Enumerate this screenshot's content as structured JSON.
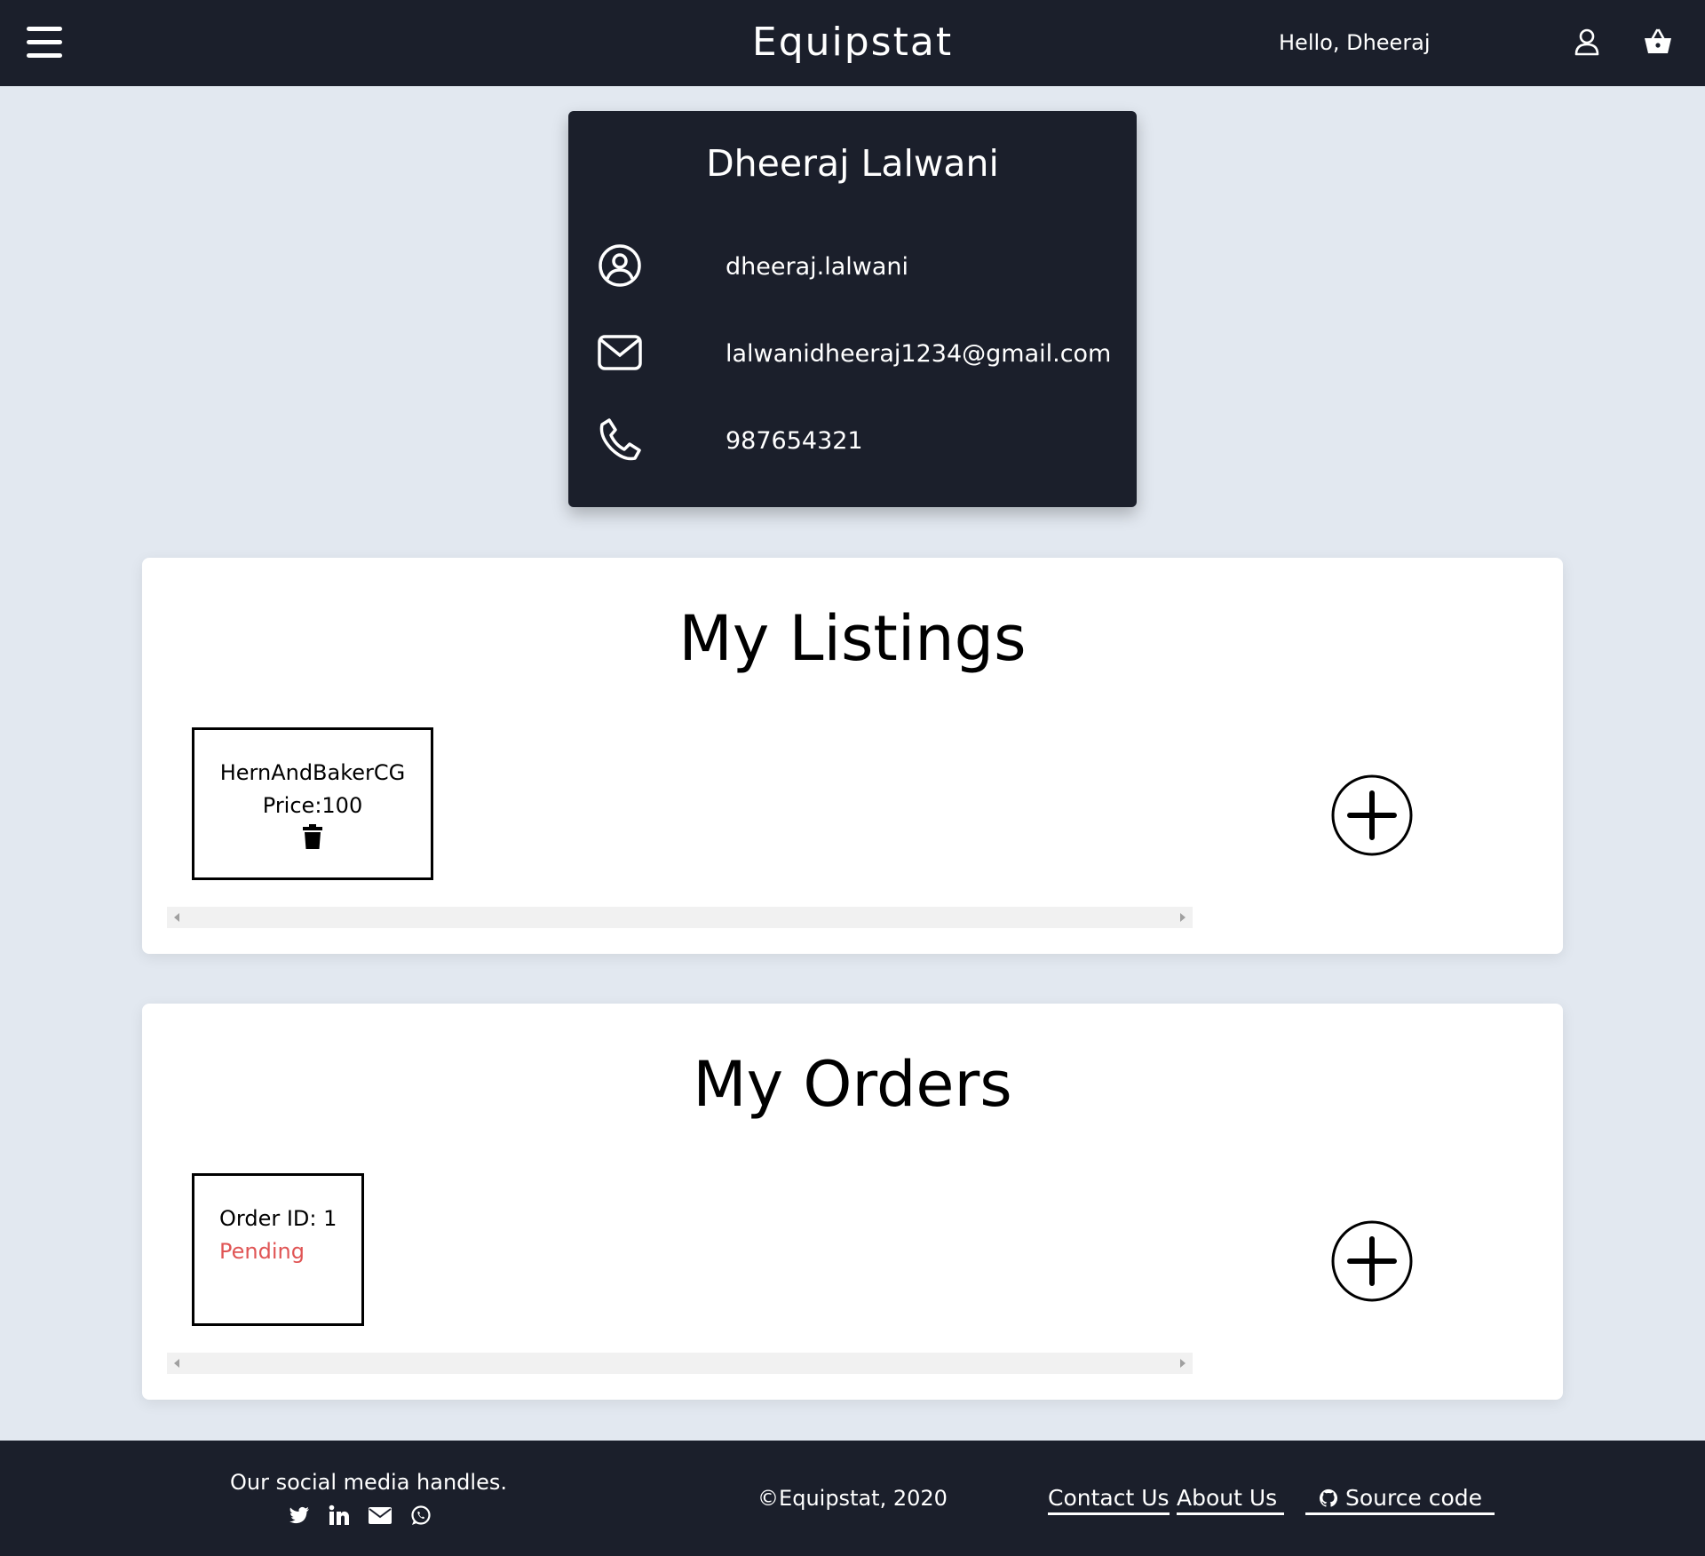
{
  "header": {
    "brand": "Equipstat",
    "greeting": "Hello, Dheeraj"
  },
  "profile": {
    "name": "Dheeraj Lalwani",
    "username": "dheeraj.lalwani",
    "email": "lalwanidheeraj1234@gmail.com",
    "phone": "987654321"
  },
  "listings": {
    "title": "My Listings",
    "items": [
      {
        "name": "HernAndBakerCG",
        "price": "Price:100"
      }
    ]
  },
  "orders": {
    "title": "My Orders",
    "items": [
      {
        "order_id": "Order ID: 1",
        "status": "Pending",
        "status_color": "#e05555"
      }
    ]
  },
  "footer": {
    "social_caption": "Our social media handles.",
    "copyright": "©Equipstat, 2020",
    "links": [
      "Contact Us",
      "About Us",
      "Source code"
    ]
  },
  "colors": {
    "dark": "#1b1f2b",
    "background": "#e2e8f0",
    "pending": "#e05555"
  },
  "icons": {
    "header": [
      "hamburger-menu-icon",
      "user-icon",
      "shopping-basket-icon"
    ],
    "profile": [
      "user-circle-icon",
      "mail-icon",
      "phone-icon"
    ],
    "social": [
      "twitter-icon",
      "linkedin-icon",
      "envelope-icon",
      "whatsapp-icon"
    ]
  }
}
